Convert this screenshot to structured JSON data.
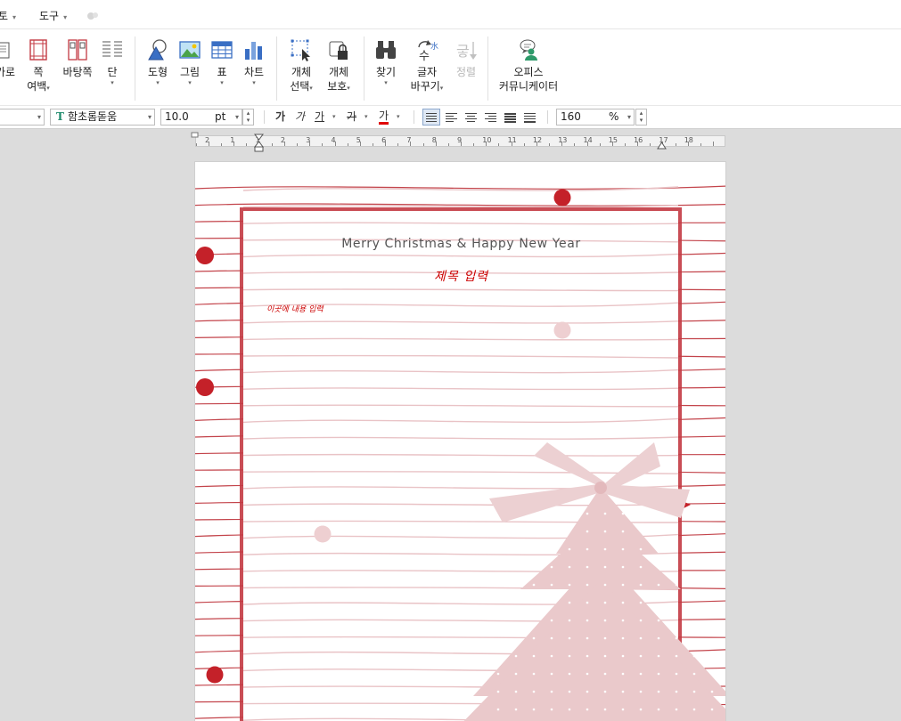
{
  "menu": {
    "items": [
      {
        "label": "토"
      },
      {
        "label": "도구"
      }
    ]
  },
  "ribbon": {
    "buttons": [
      {
        "id": "garo",
        "line1": "가로",
        "line2": ""
      },
      {
        "id": "page-margin",
        "line1": "쪽",
        "line2": "여백"
      },
      {
        "id": "background-page",
        "line1": "바탕쪽",
        "line2": ""
      },
      {
        "id": "column",
        "line1": "단",
        "line2": ""
      },
      {
        "id": "shape",
        "line1": "도형",
        "line2": ""
      },
      {
        "id": "picture",
        "line1": "그림",
        "line2": ""
      },
      {
        "id": "table",
        "line1": "표",
        "line2": ""
      },
      {
        "id": "chart",
        "line1": "차트",
        "line2": ""
      },
      {
        "id": "select-object",
        "line1": "개체",
        "line2": "선택"
      },
      {
        "id": "protect-object",
        "line1": "개체",
        "line2": "보호"
      },
      {
        "id": "find",
        "line1": "찾기",
        "line2": ""
      },
      {
        "id": "replace-char",
        "line1": "글자",
        "line2": "바꾸기"
      },
      {
        "id": "sort",
        "line1": "정렬",
        "line2": ""
      },
      {
        "id": "office-communicator",
        "line1": "오피스",
        "line2": "커뮤니케이터"
      }
    ],
    "replace_icon_char": "수",
    "replace_icon_small": "水",
    "sort_icon_char": "긓"
  },
  "format": {
    "font_name": "함초롬돋움",
    "font_icon": "T",
    "font_size": "10.0",
    "font_unit": "pt",
    "bold": "가",
    "italic": "가",
    "underline": "가",
    "strike": "가",
    "color": "가",
    "zoom": "160",
    "zoom_unit": "%"
  },
  "ruler": {
    "numbers": [
      "2",
      "1",
      "1",
      "2",
      "3",
      "4",
      "5",
      "6",
      "7",
      "8",
      "9",
      "10",
      "11",
      "12",
      "13",
      "14",
      "15",
      "16",
      "17",
      "18"
    ]
  },
  "document": {
    "greeting": "Merry Christmas & Happy New Year",
    "title": "제목 입력",
    "body": "이곳에 내용 입력"
  },
  "colors": {
    "accent_red": "#c42129",
    "frame_red": "#c33a43",
    "tree_pink": "#eac9cb"
  }
}
